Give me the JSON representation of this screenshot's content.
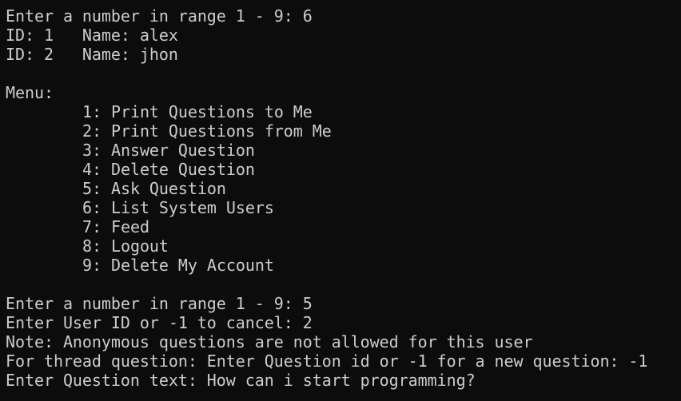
{
  "console": {
    "lines": [
      "Enter a number in range 1 - 9: 6",
      "ID: 1   Name: alex",
      "ID: 2   Name: jhon",
      "",
      "Menu:",
      "1: Print Questions to Me",
      "2: Print Questions from Me",
      "3: Answer Question",
      "4: Delete Question",
      "5: Ask Question",
      "6: List System Users",
      "7: Feed",
      "8: Logout",
      "9: Delete My Account",
      "",
      "Enter a number in range 1 - 9: 5",
      "Enter User ID or -1 to cancel: 2",
      "Note: Anonymous questions are not allowed for this user",
      "For thread question: Enter Question id or -1 for a new question: -1",
      "Enter Question text: How can i start programming?"
    ]
  }
}
